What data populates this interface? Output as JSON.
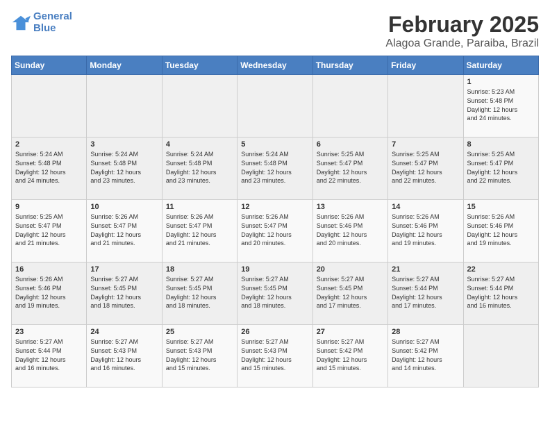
{
  "header": {
    "logo_line1": "General",
    "logo_line2": "Blue",
    "title": "February 2025",
    "subtitle": "Alagoa Grande, Paraiba, Brazil"
  },
  "weekdays": [
    "Sunday",
    "Monday",
    "Tuesday",
    "Wednesday",
    "Thursday",
    "Friday",
    "Saturday"
  ],
  "weeks": [
    [
      {
        "day": "",
        "info": ""
      },
      {
        "day": "",
        "info": ""
      },
      {
        "day": "",
        "info": ""
      },
      {
        "day": "",
        "info": ""
      },
      {
        "day": "",
        "info": ""
      },
      {
        "day": "",
        "info": ""
      },
      {
        "day": "1",
        "info": "Sunrise: 5:23 AM\nSunset: 5:48 PM\nDaylight: 12 hours\nand 24 minutes."
      }
    ],
    [
      {
        "day": "2",
        "info": "Sunrise: 5:24 AM\nSunset: 5:48 PM\nDaylight: 12 hours\nand 24 minutes."
      },
      {
        "day": "3",
        "info": "Sunrise: 5:24 AM\nSunset: 5:48 PM\nDaylight: 12 hours\nand 23 minutes."
      },
      {
        "day": "4",
        "info": "Sunrise: 5:24 AM\nSunset: 5:48 PM\nDaylight: 12 hours\nand 23 minutes."
      },
      {
        "day": "5",
        "info": "Sunrise: 5:24 AM\nSunset: 5:48 PM\nDaylight: 12 hours\nand 23 minutes."
      },
      {
        "day": "6",
        "info": "Sunrise: 5:25 AM\nSunset: 5:47 PM\nDaylight: 12 hours\nand 22 minutes."
      },
      {
        "day": "7",
        "info": "Sunrise: 5:25 AM\nSunset: 5:47 PM\nDaylight: 12 hours\nand 22 minutes."
      },
      {
        "day": "8",
        "info": "Sunrise: 5:25 AM\nSunset: 5:47 PM\nDaylight: 12 hours\nand 22 minutes."
      }
    ],
    [
      {
        "day": "9",
        "info": "Sunrise: 5:25 AM\nSunset: 5:47 PM\nDaylight: 12 hours\nand 21 minutes."
      },
      {
        "day": "10",
        "info": "Sunrise: 5:26 AM\nSunset: 5:47 PM\nDaylight: 12 hours\nand 21 minutes."
      },
      {
        "day": "11",
        "info": "Sunrise: 5:26 AM\nSunset: 5:47 PM\nDaylight: 12 hours\nand 21 minutes."
      },
      {
        "day": "12",
        "info": "Sunrise: 5:26 AM\nSunset: 5:47 PM\nDaylight: 12 hours\nand 20 minutes."
      },
      {
        "day": "13",
        "info": "Sunrise: 5:26 AM\nSunset: 5:46 PM\nDaylight: 12 hours\nand 20 minutes."
      },
      {
        "day": "14",
        "info": "Sunrise: 5:26 AM\nSunset: 5:46 PM\nDaylight: 12 hours\nand 19 minutes."
      },
      {
        "day": "15",
        "info": "Sunrise: 5:26 AM\nSunset: 5:46 PM\nDaylight: 12 hours\nand 19 minutes."
      }
    ],
    [
      {
        "day": "16",
        "info": "Sunrise: 5:26 AM\nSunset: 5:46 PM\nDaylight: 12 hours\nand 19 minutes."
      },
      {
        "day": "17",
        "info": "Sunrise: 5:27 AM\nSunset: 5:45 PM\nDaylight: 12 hours\nand 18 minutes."
      },
      {
        "day": "18",
        "info": "Sunrise: 5:27 AM\nSunset: 5:45 PM\nDaylight: 12 hours\nand 18 minutes."
      },
      {
        "day": "19",
        "info": "Sunrise: 5:27 AM\nSunset: 5:45 PM\nDaylight: 12 hours\nand 18 minutes."
      },
      {
        "day": "20",
        "info": "Sunrise: 5:27 AM\nSunset: 5:45 PM\nDaylight: 12 hours\nand 17 minutes."
      },
      {
        "day": "21",
        "info": "Sunrise: 5:27 AM\nSunset: 5:44 PM\nDaylight: 12 hours\nand 17 minutes."
      },
      {
        "day": "22",
        "info": "Sunrise: 5:27 AM\nSunset: 5:44 PM\nDaylight: 12 hours\nand 16 minutes."
      }
    ],
    [
      {
        "day": "23",
        "info": "Sunrise: 5:27 AM\nSunset: 5:44 PM\nDaylight: 12 hours\nand 16 minutes."
      },
      {
        "day": "24",
        "info": "Sunrise: 5:27 AM\nSunset: 5:43 PM\nDaylight: 12 hours\nand 16 minutes."
      },
      {
        "day": "25",
        "info": "Sunrise: 5:27 AM\nSunset: 5:43 PM\nDaylight: 12 hours\nand 15 minutes."
      },
      {
        "day": "26",
        "info": "Sunrise: 5:27 AM\nSunset: 5:43 PM\nDaylight: 12 hours\nand 15 minutes."
      },
      {
        "day": "27",
        "info": "Sunrise: 5:27 AM\nSunset: 5:42 PM\nDaylight: 12 hours\nand 15 minutes."
      },
      {
        "day": "28",
        "info": "Sunrise: 5:27 AM\nSunset: 5:42 PM\nDaylight: 12 hours\nand 14 minutes."
      },
      {
        "day": "",
        "info": ""
      }
    ]
  ]
}
